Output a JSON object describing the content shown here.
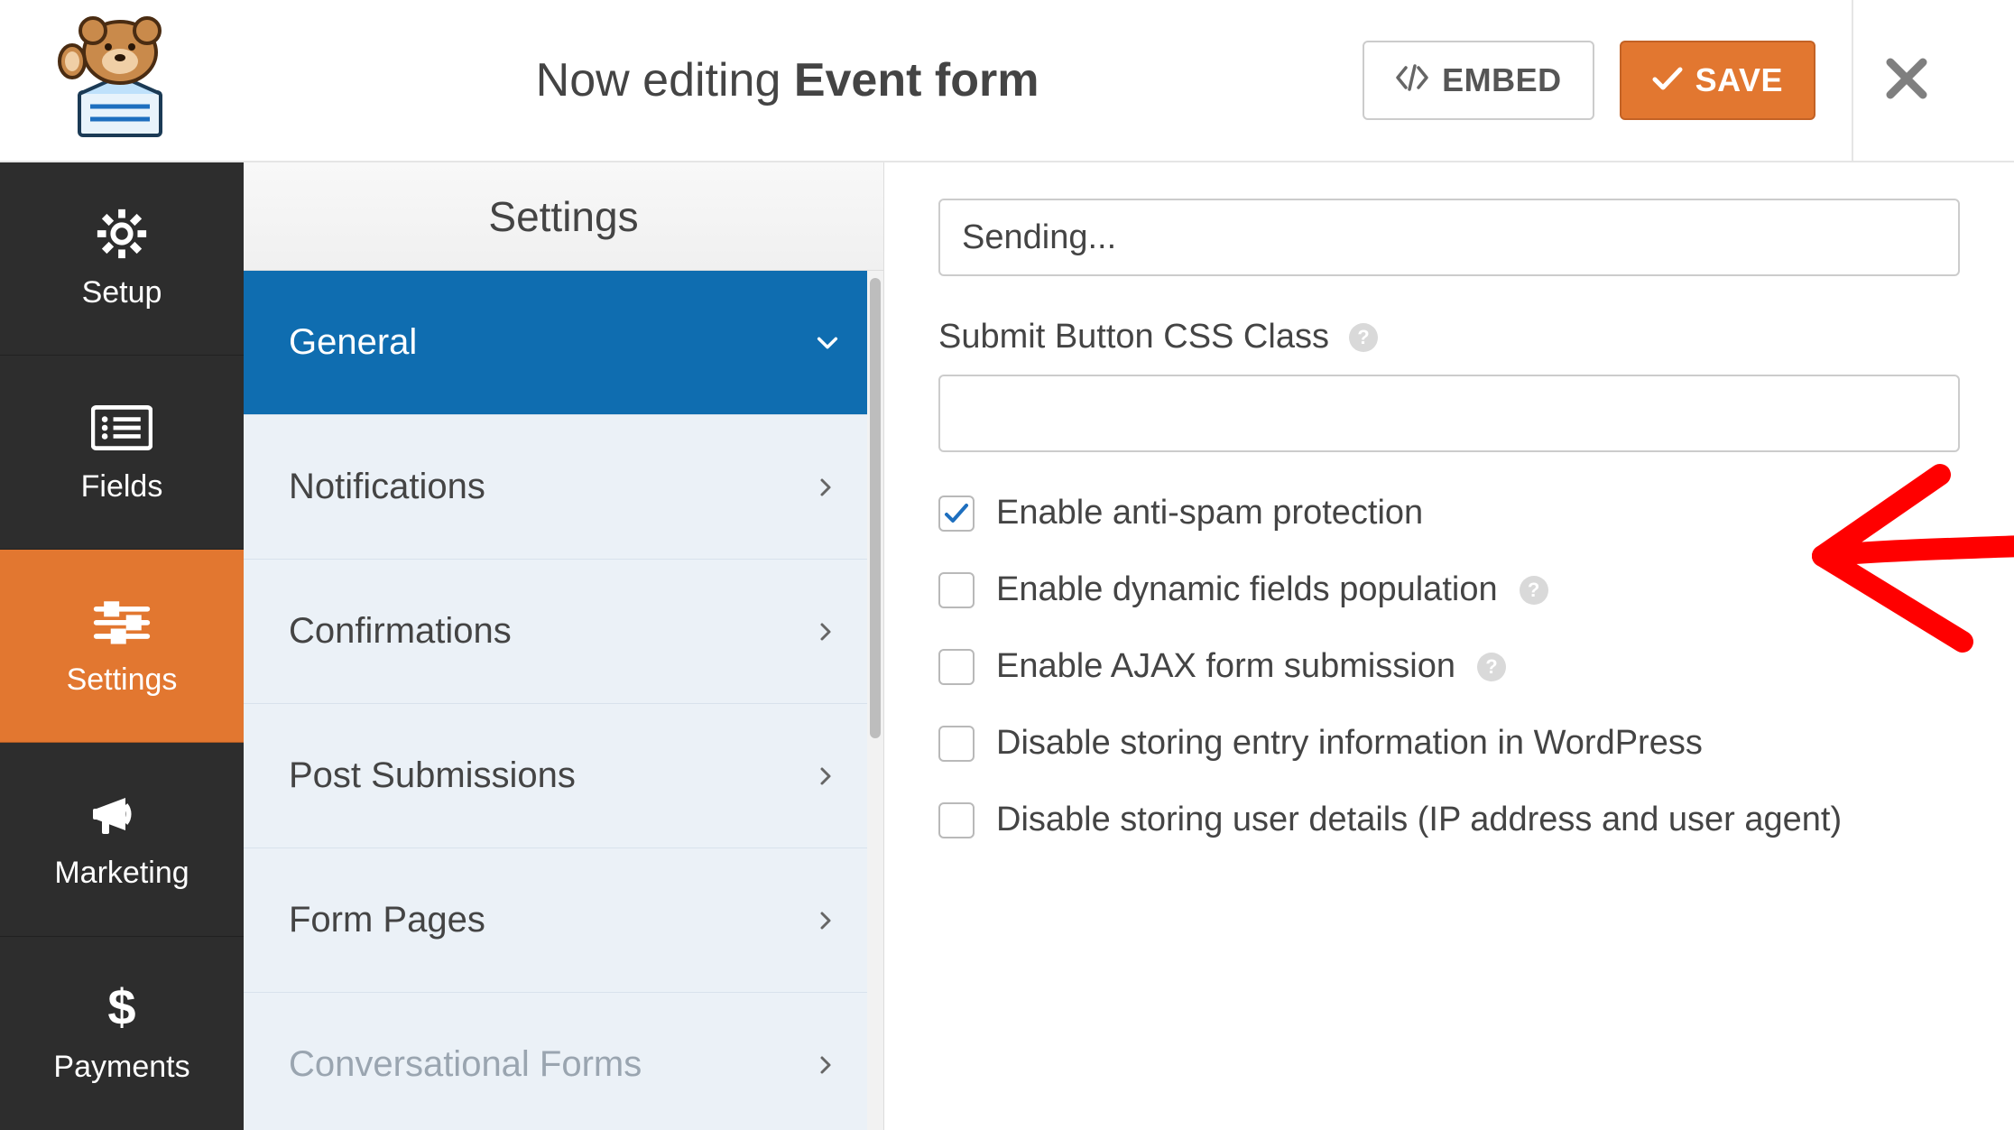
{
  "header": {
    "editing_prefix": "Now editing ",
    "form_name": "Event form",
    "embed_label": "EMBED",
    "save_label": "SAVE"
  },
  "sidebar": {
    "items": [
      {
        "label": "Setup"
      },
      {
        "label": "Fields"
      },
      {
        "label": "Settings"
      },
      {
        "label": "Marketing"
      },
      {
        "label": "Payments"
      }
    ]
  },
  "mid_panel": {
    "title": "Settings",
    "items": [
      {
        "label": "General",
        "active": true,
        "chevron": "down"
      },
      {
        "label": "Notifications",
        "chevron": "right"
      },
      {
        "label": "Confirmations",
        "chevron": "right"
      },
      {
        "label": "Post Submissions",
        "chevron": "right"
      },
      {
        "label": "Form Pages",
        "chevron": "right"
      },
      {
        "label": "Conversational Forms",
        "chevron": "right",
        "disabled": true
      }
    ]
  },
  "content": {
    "sending_value": "Sending...",
    "css_class_label": "Submit Button CSS Class",
    "css_class_value": "",
    "checks": [
      {
        "label": "Enable anti-spam protection",
        "checked": true,
        "help": false
      },
      {
        "label": "Enable dynamic fields population",
        "checked": false,
        "help": true
      },
      {
        "label": "Enable AJAX form submission",
        "checked": false,
        "help": true
      },
      {
        "label": "Disable storing entry information in WordPress",
        "checked": false,
        "help": false
      },
      {
        "label": "Disable storing user details (IP address and user agent)",
        "checked": false,
        "help": false
      }
    ]
  }
}
